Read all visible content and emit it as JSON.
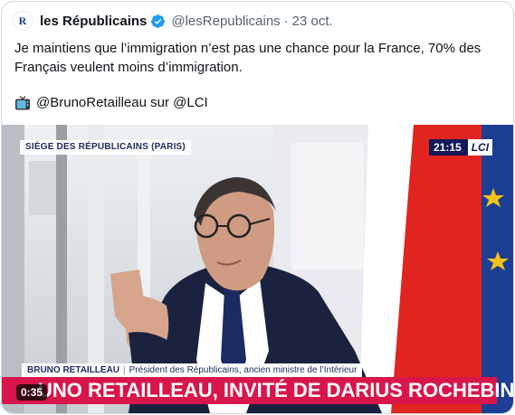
{
  "tweet": {
    "display_name": "les Républicains",
    "handle": "@lesRepublicains",
    "separator": "·",
    "timestamp": "23 oct.",
    "avatar_letter": "R",
    "text_lines": [
      "Je maintiens que l’immigration n’est pas une chance pour la France, 70% des",
      "Français veulent moins d’immigration."
    ],
    "credit": "@BrunoRetailleau sur @LCI",
    "verified_color": "#1d9bf0"
  },
  "media": {
    "location_banner": "SIÈGE DES RÉPUBLICAINS (PARIS)",
    "clock": "21:15",
    "channel_logo": "LCI",
    "guest_name": "BRUNO RETAILLEAU",
    "guest_separator": "|",
    "guest_title": "Président des Républicains, ancien ministre de l’Intérieur",
    "ticker": "UNO RETAILLEAU, INVITÉ DE DARIUS ROCHEBIN",
    "duration": "0:35",
    "ticker_color": "#d8164b",
    "flag_colors": [
      "#ffffff",
      "#e1241f"
    ],
    "eu_flag_color": "#1c3f94"
  }
}
